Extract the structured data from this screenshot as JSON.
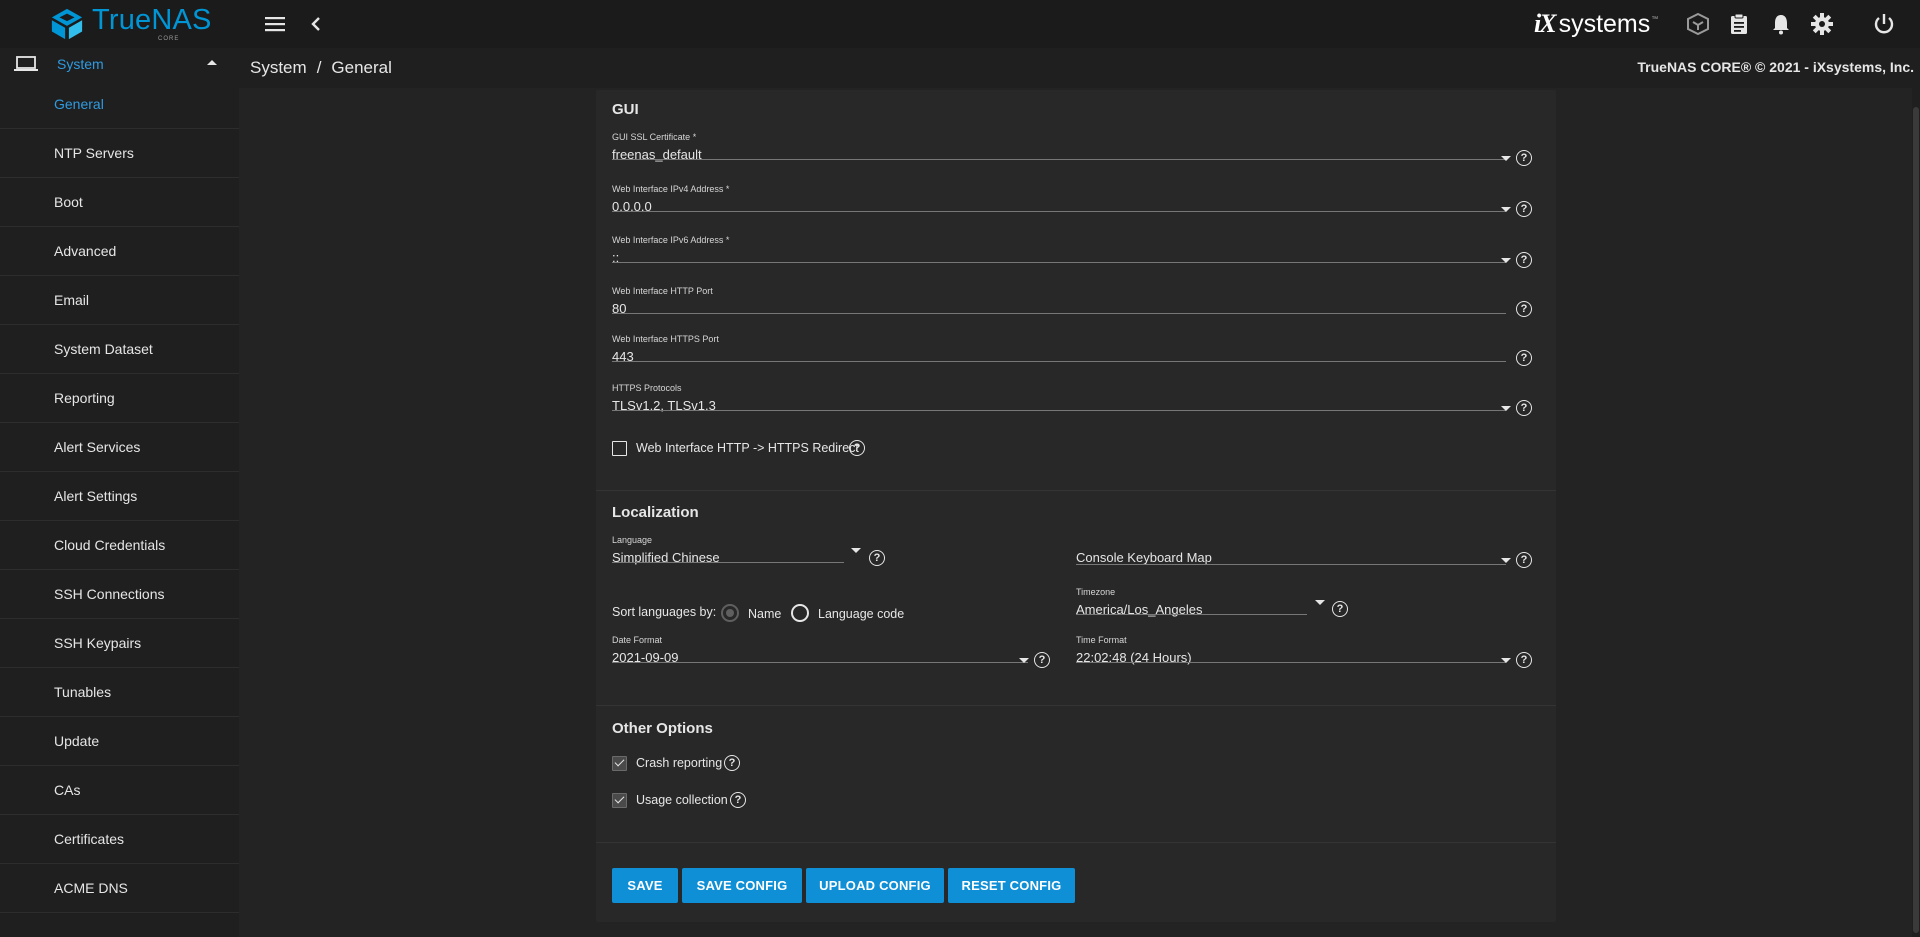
{
  "app": {
    "logo_true": "True",
    "logo_nas": "NAS",
    "logo_sub": "CORE",
    "vendor_i": "i",
    "vendor_x": "X",
    "vendor_systems": "systems",
    "vendor_tm": "™",
    "icons": [
      "menu-icon",
      "chevron-left-icon",
      "truecommand-icon",
      "clipboard-icon",
      "bell-icon",
      "gear-icon",
      "power-icon"
    ]
  },
  "sidebar": {
    "parent_label": "System",
    "items": [
      {
        "label": "General",
        "active": true
      },
      {
        "label": "NTP Servers"
      },
      {
        "label": "Boot"
      },
      {
        "label": "Advanced"
      },
      {
        "label": "Email"
      },
      {
        "label": "System Dataset"
      },
      {
        "label": "Reporting"
      },
      {
        "label": "Alert Services"
      },
      {
        "label": "Alert Settings"
      },
      {
        "label": "Cloud Credentials"
      },
      {
        "label": "SSH Connections"
      },
      {
        "label": "SSH Keypairs"
      },
      {
        "label": "Tunables"
      },
      {
        "label": "Update"
      },
      {
        "label": "CAs"
      },
      {
        "label": "Certificates"
      },
      {
        "label": "ACME DNS"
      }
    ]
  },
  "breadcrumb": {
    "root": "System",
    "separator": "/",
    "current": "General"
  },
  "copyright": "TrueNAS CORE® © 2021 - iXsystems, Inc.",
  "gui": {
    "title": "GUI",
    "ssl_cert": {
      "label": "GUI SSL Certificate *",
      "value": "freenas_default"
    },
    "ipv4": {
      "label": "Web Interface IPv4 Address *",
      "value": "0.0.0.0"
    },
    "ipv6": {
      "label": "Web Interface IPv6 Address *",
      "value": "::"
    },
    "http_port": {
      "label": "Web Interface HTTP Port",
      "value": "80"
    },
    "https_port": {
      "label": "Web Interface HTTPS Port",
      "value": "443"
    },
    "https_protocols": {
      "label": "HTTPS Protocols",
      "value": "TLSv1.2, TLSv1.3"
    },
    "redirect": {
      "label": "Web Interface HTTP -> HTTPS Redirect",
      "checked": false
    }
  },
  "localization": {
    "title": "Localization",
    "language": {
      "label": "Language",
      "value": "Simplified Chinese"
    },
    "keyboard_map": {
      "value": "Console Keyboard Map"
    },
    "sort_label": "Sort languages by:",
    "sort_options": [
      {
        "label": "Name",
        "selected": true,
        "disabled": true
      },
      {
        "label": "Language code",
        "selected": false
      }
    ],
    "timezone": {
      "label": "Timezone",
      "value": "America/Los_Angeles"
    },
    "date_format": {
      "label": "Date Format",
      "value": "2021-09-09"
    },
    "time_format": {
      "label": "Time Format",
      "value": "22:02:48 (24 Hours)"
    }
  },
  "other": {
    "title": "Other Options",
    "crash_reporting": {
      "label": "Crash reporting",
      "checked": true
    },
    "usage_collection": {
      "label": "Usage collection",
      "checked": true
    }
  },
  "actions": {
    "save": "SAVE",
    "save_config": "SAVE CONFIG",
    "upload_config": "UPLOAD CONFIG",
    "reset_config": "RESET CONFIG"
  },
  "colors": {
    "accent": "#0f8fd6",
    "active_link": "#2f9be0",
    "background": "#232323",
    "card": "#282828"
  }
}
